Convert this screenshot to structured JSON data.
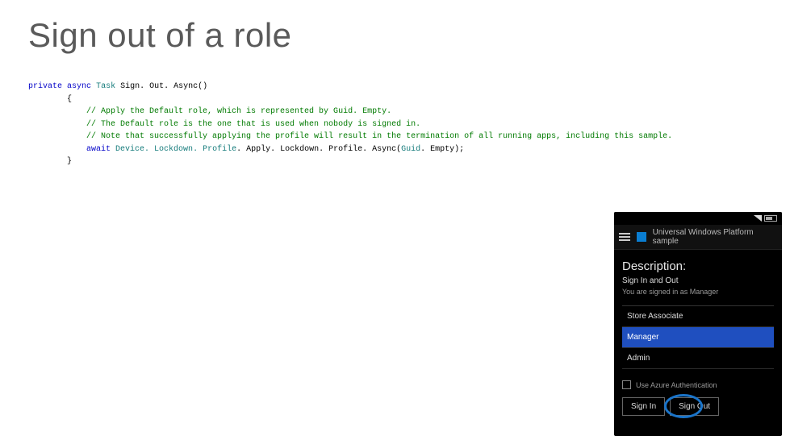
{
  "title": "Sign out of a role",
  "code": {
    "l1": {
      "kw1": "private",
      "kw2": "async",
      "type": "Task",
      "name": "Sign. Out. Async()"
    },
    "l2": "        {",
    "c1": "            // Apply the Default role, which is represented by Guid. Empty.",
    "c2": "            // The Default role is the one that is used when nobody is signed in.",
    "c3": "            // Note that successfully applying the profile will result in the termination of all running apps, including this sample.",
    "await_kw": "await",
    "await_type_a": "Device. Lockdown. Profile",
    "await_mid": ". Apply. Lockdown. Profile. Async(",
    "await_type_b": "Guid",
    "await_tail": ". Empty);",
    "l6": "        }"
  },
  "phone": {
    "app_title": "Universal Windows Platform sample",
    "desc": "Description:",
    "sub1": "Sign In and Out",
    "sub2": "You are signed in as Manager",
    "roles": [
      "Store Associate",
      "Manager",
      "Admin"
    ],
    "selected_role_index": 1,
    "use_azure": "Use Azure Authentication",
    "btn_signin": "Sign In",
    "btn_signout": "Sign Out"
  }
}
